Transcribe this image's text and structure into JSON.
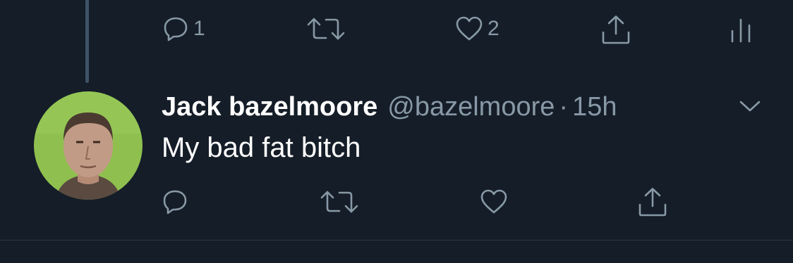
{
  "previous_tweet": {
    "actions": {
      "reply_count": "1",
      "retweet_count": "",
      "like_count": "2"
    }
  },
  "tweet": {
    "display_name": "Jack bazelmoore",
    "handle": "@bazelmoore",
    "separator": "·",
    "time": "15h",
    "text": "My bad fat bitch",
    "avatar_background": "#8fc04f"
  },
  "icons": {
    "reply": "reply-icon",
    "retweet": "retweet-icon",
    "like": "heart-icon",
    "share": "share-icon",
    "analytics": "analytics-icon",
    "menu": "chevron-down-icon"
  },
  "colors": {
    "background": "#151d28",
    "primary_text": "#ffffff",
    "secondary_text": "#8899a6",
    "thread_line": "#3d5466",
    "divider": "#2c3a48"
  }
}
